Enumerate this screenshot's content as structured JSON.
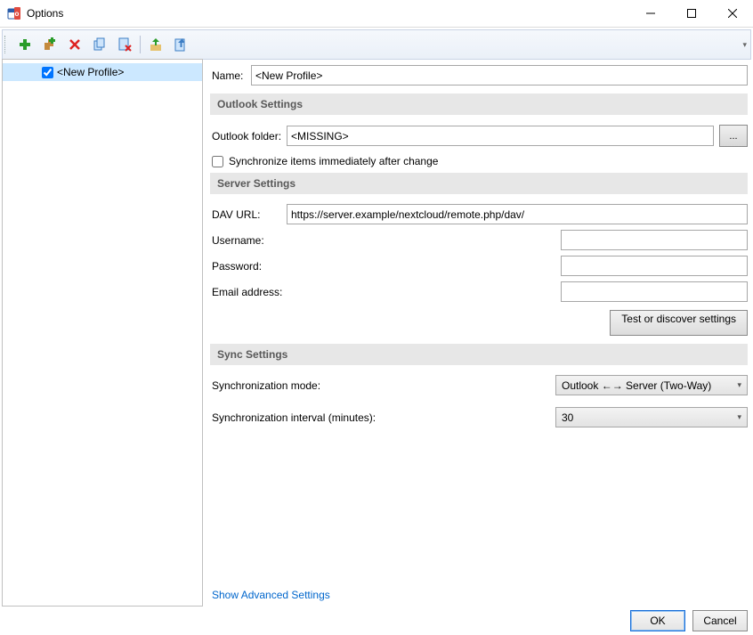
{
  "window": {
    "title": "Options"
  },
  "toolbar": {
    "add_icon": "add-icon",
    "addmulti_icon": "add-multiple-icon",
    "delete_icon": "delete-icon",
    "copy_icon": "copy-icon",
    "cleanup_icon": "cleanup-icon",
    "import_icon": "import-icon",
    "export_icon": "export-icon"
  },
  "profiles": {
    "items": [
      {
        "label": "<New Profile>",
        "checked": true
      }
    ]
  },
  "name": {
    "label": "Name:",
    "value": "<New Profile>"
  },
  "sections": {
    "outlook": "Outlook Settings",
    "server": "Server Settings",
    "sync": "Sync Settings"
  },
  "outlook": {
    "folder_label": "Outlook folder:",
    "folder_value": "<MISSING>",
    "browse": "...",
    "sync_immediate_label": "Synchronize items immediately after change"
  },
  "server": {
    "dav_label": "DAV URL:",
    "dav_value": "https://server.example/nextcloud/remote.php/dav/",
    "user_label": "Username:",
    "user_value": "",
    "pass_label": "Password:",
    "pass_value": "",
    "email_label": "Email address:",
    "email_value": "",
    "test_label": "Test or discover settings"
  },
  "sync": {
    "mode_label": "Synchronization mode:",
    "mode_value": "Outlook ←→ Server (Two-Way)",
    "interval_label": "Synchronization interval (minutes):",
    "interval_value": "30"
  },
  "advanced": "Show Advanced Settings",
  "buttons": {
    "ok": "OK",
    "cancel": "Cancel"
  }
}
